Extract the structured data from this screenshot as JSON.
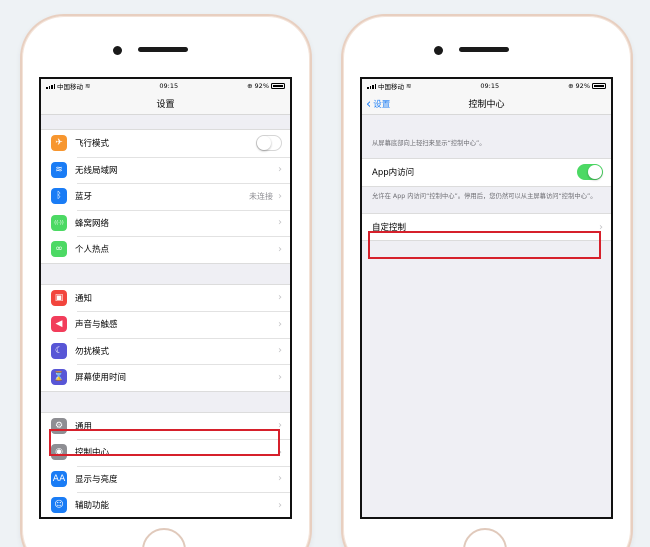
{
  "status": {
    "carrier": "中国移动",
    "time": "09:15",
    "battery": "92%"
  },
  "left": {
    "title": "设置",
    "group1": [
      {
        "label": "飞行模式",
        "icon": "airplane-icon",
        "color": "#f7962f",
        "glyph": "✈",
        "accessory": "toggle-off"
      },
      {
        "label": "无线局域网",
        "icon": "wifi-icon",
        "color": "#1a7cf5",
        "glyph": "≋",
        "accessory": "chevron"
      },
      {
        "label": "蓝牙",
        "icon": "bluetooth-icon",
        "color": "#1a7cf5",
        "glyph": "ᛒ",
        "accessory": "chevron",
        "value": "未连接"
      },
      {
        "label": "蜂窝网络",
        "icon": "cellular-icon",
        "color": "#4cd964",
        "glyph": "((·))",
        "accessory": "chevron"
      },
      {
        "label": "个人热点",
        "icon": "hotspot-icon",
        "color": "#4cd964",
        "glyph": "∞",
        "accessory": "chevron"
      }
    ],
    "group2": [
      {
        "label": "通知",
        "icon": "notification-icon",
        "color": "#f2453d",
        "glyph": "▣",
        "accessory": "chevron"
      },
      {
        "label": "声音与触感",
        "icon": "sound-icon",
        "color": "#f23d5b",
        "glyph": "◀",
        "accessory": "chevron"
      },
      {
        "label": "勿扰模式",
        "icon": "moon-icon",
        "color": "#5856d6",
        "glyph": "☾",
        "accessory": "chevron"
      },
      {
        "label": "屏幕使用时间",
        "icon": "hourglass-icon",
        "color": "#5856d6",
        "glyph": "⌛",
        "accessory": "chevron"
      }
    ],
    "group3": [
      {
        "label": "通用",
        "icon": "gear-icon",
        "color": "#8e8e93",
        "glyph": "⚙",
        "accessory": "chevron"
      },
      {
        "label": "控制中心",
        "icon": "control-center-icon",
        "color": "#8e8e93",
        "glyph": "◉",
        "accessory": "chevron"
      },
      {
        "label": "显示与亮度",
        "icon": "display-icon",
        "color": "#1a7cf5",
        "glyph": "AA",
        "accessory": "chevron"
      },
      {
        "label": "辅助功能",
        "icon": "accessibility-icon",
        "color": "#1a7cf5",
        "glyph": "☺",
        "accessory": "chevron"
      }
    ]
  },
  "right": {
    "back_label": "设置",
    "title": "控制中心",
    "header_note": "从屏幕底部向上轻扫来显示“控制中心”。",
    "app_access_label": "App内访问",
    "app_access_on": true,
    "app_access_note": "允许在 App 内访问“控制中心”。停用后，您仍然可以从主屏幕访问“控制中心”。",
    "customize_label": "自定控制"
  },
  "colors": {
    "highlight": "#d6202b",
    "accent": "#1a7cf5",
    "toggle_on": "#4cd964"
  }
}
